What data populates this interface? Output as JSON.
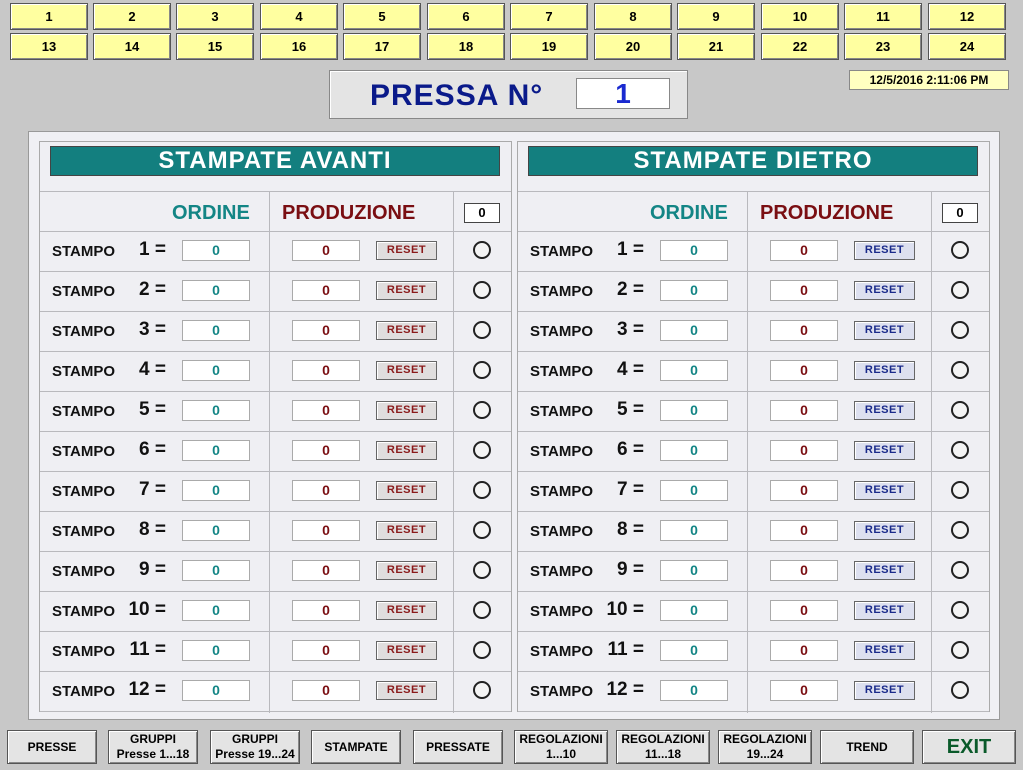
{
  "press_buttons_row1": [
    "1",
    "2",
    "3",
    "4",
    "5",
    "6",
    "7",
    "8",
    "9",
    "10",
    "11",
    "12"
  ],
  "press_buttons_row2": [
    "13",
    "14",
    "15",
    "16",
    "17",
    "18",
    "19",
    "20",
    "21",
    "22",
    "23",
    "24"
  ],
  "header": {
    "label": "PRESSA  N°",
    "value": "1"
  },
  "datetime": "12/5/2016 2:11:06 PM",
  "avanti": {
    "title": "STAMPATE  AVANTI",
    "col_ordine": "ORDINE",
    "col_produzione": "PRODUZIONE",
    "total": "0",
    "reset_label": "RESET",
    "rows": [
      {
        "label": "STAMPO",
        "num": "1 =",
        "ordine": "0",
        "produzione": "0"
      },
      {
        "label": "STAMPO",
        "num": "2 =",
        "ordine": "0",
        "produzione": "0"
      },
      {
        "label": "STAMPO",
        "num": "3 =",
        "ordine": "0",
        "produzione": "0"
      },
      {
        "label": "STAMPO",
        "num": "4 =",
        "ordine": "0",
        "produzione": "0"
      },
      {
        "label": "STAMPO",
        "num": "5 =",
        "ordine": "0",
        "produzione": "0"
      },
      {
        "label": "STAMPO",
        "num": "6 =",
        "ordine": "0",
        "produzione": "0"
      },
      {
        "label": "STAMPO",
        "num": "7 =",
        "ordine": "0",
        "produzione": "0"
      },
      {
        "label": "STAMPO",
        "num": "8 =",
        "ordine": "0",
        "produzione": "0"
      },
      {
        "label": "STAMPO",
        "num": "9 =",
        "ordine": "0",
        "produzione": "0"
      },
      {
        "label": "STAMPO",
        "num": "10 =",
        "ordine": "0",
        "produzione": "0"
      },
      {
        "label": "STAMPO",
        "num": "11 =",
        "ordine": "0",
        "produzione": "0"
      },
      {
        "label": "STAMPO",
        "num": "12 =",
        "ordine": "0",
        "produzione": "0"
      }
    ]
  },
  "dietro": {
    "title": "STAMPATE  DIETRO",
    "col_ordine": "ORDINE",
    "col_produzione": "PRODUZIONE",
    "total": "0",
    "reset_label": "RESET",
    "rows": [
      {
        "label": "STAMPO",
        "num": "1 =",
        "ordine": "0",
        "produzione": "0"
      },
      {
        "label": "STAMPO",
        "num": "2 =",
        "ordine": "0",
        "produzione": "0"
      },
      {
        "label": "STAMPO",
        "num": "3 =",
        "ordine": "0",
        "produzione": "0"
      },
      {
        "label": "STAMPO",
        "num": "4 =",
        "ordine": "0",
        "produzione": "0"
      },
      {
        "label": "STAMPO",
        "num": "5 =",
        "ordine": "0",
        "produzione": "0"
      },
      {
        "label": "STAMPO",
        "num": "6 =",
        "ordine": "0",
        "produzione": "0"
      },
      {
        "label": "STAMPO",
        "num": "7 =",
        "ordine": "0",
        "produzione": "0"
      },
      {
        "label": "STAMPO",
        "num": "8 =",
        "ordine": "0",
        "produzione": "0"
      },
      {
        "label": "STAMPO",
        "num": "9 =",
        "ordine": "0",
        "produzione": "0"
      },
      {
        "label": "STAMPO",
        "num": "10 =",
        "ordine": "0",
        "produzione": "0"
      },
      {
        "label": "STAMPO",
        "num": "11 =",
        "ordine": "0",
        "produzione": "0"
      },
      {
        "label": "STAMPO",
        "num": "12 =",
        "ordine": "0",
        "produzione": "0"
      }
    ]
  },
  "bottom_buttons": [
    "PRESSE",
    "GRUPPI\nPresse 1...18",
    "GRUPPI\nPresse 19...24",
    "STAMPATE",
    "PRESSATE",
    "REGOLAZIONI\n1...10",
    "REGOLAZIONI\n11...18",
    "REGOLAZIONI\n19...24",
    "TREND",
    "EXIT"
  ],
  "colors": {
    "title_bg": "#137f7f",
    "ordine": "#138585",
    "produzione": "#7a0e12",
    "press_btn": "#ffffa0",
    "header_text": "#0a1a8a"
  }
}
